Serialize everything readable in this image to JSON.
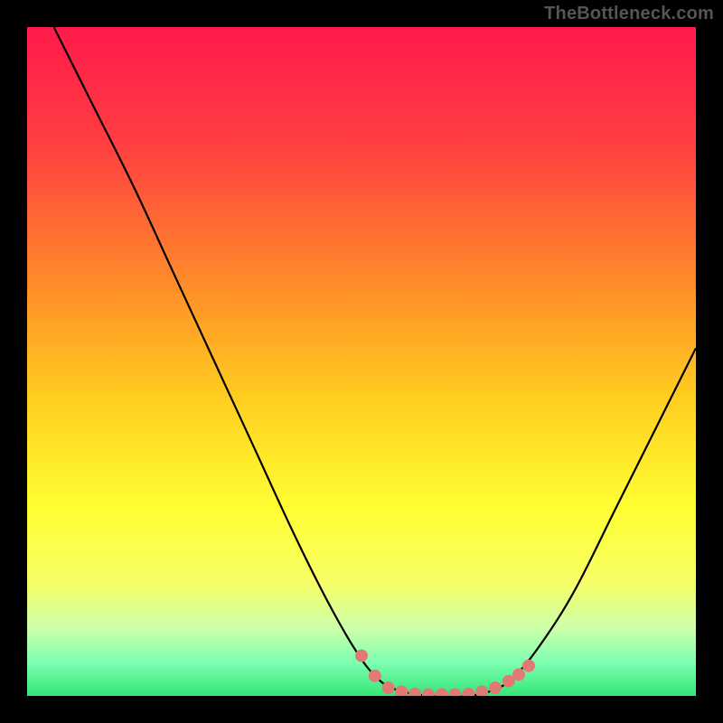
{
  "watermark": "TheBottleneck.com",
  "colors": {
    "background": "#000000",
    "curve": "#000000",
    "marker_fill": "#e17a75",
    "watermark": "#555555"
  },
  "gradient_stops": [
    {
      "offset": 0.0,
      "color": "#ff1a4b"
    },
    {
      "offset": 0.18,
      "color": "#ff4040"
    },
    {
      "offset": 0.38,
      "color": "#ff8a2a"
    },
    {
      "offset": 0.55,
      "color": "#ffcc1f"
    },
    {
      "offset": 0.72,
      "color": "#ffff33"
    },
    {
      "offset": 0.83,
      "color": "#f6ff66"
    },
    {
      "offset": 0.9,
      "color": "#ccffaa"
    },
    {
      "offset": 0.95,
      "color": "#7dffb0"
    },
    {
      "offset": 1.0,
      "color": "#33e676"
    }
  ],
  "chart_data": {
    "type": "line",
    "title": "",
    "xlabel": "",
    "ylabel": "",
    "xlim": [
      0,
      100
    ],
    "ylim": [
      0,
      100
    ],
    "curve": [
      {
        "x": 4,
        "y": 100
      },
      {
        "x": 6,
        "y": 96
      },
      {
        "x": 10,
        "y": 88
      },
      {
        "x": 16,
        "y": 76
      },
      {
        "x": 22,
        "y": 63
      },
      {
        "x": 28,
        "y": 50
      },
      {
        "x": 34,
        "y": 37
      },
      {
        "x": 40,
        "y": 24
      },
      {
        "x": 45,
        "y": 14
      },
      {
        "x": 49,
        "y": 7
      },
      {
        "x": 52,
        "y": 3
      },
      {
        "x": 55,
        "y": 1
      },
      {
        "x": 60,
        "y": 0
      },
      {
        "x": 66,
        "y": 0
      },
      {
        "x": 70,
        "y": 1
      },
      {
        "x": 73,
        "y": 3
      },
      {
        "x": 77,
        "y": 8
      },
      {
        "x": 82,
        "y": 16
      },
      {
        "x": 88,
        "y": 28
      },
      {
        "x": 94,
        "y": 40
      },
      {
        "x": 100,
        "y": 52
      }
    ],
    "markers": [
      {
        "x": 50,
        "y": 6
      },
      {
        "x": 52,
        "y": 3
      },
      {
        "x": 54,
        "y": 1.2
      },
      {
        "x": 56,
        "y": 0.6
      },
      {
        "x": 58,
        "y": 0.3
      },
      {
        "x": 60,
        "y": 0.2
      },
      {
        "x": 62,
        "y": 0.2
      },
      {
        "x": 64,
        "y": 0.2
      },
      {
        "x": 66,
        "y": 0.3
      },
      {
        "x": 68,
        "y": 0.6
      },
      {
        "x": 70,
        "y": 1.2
      },
      {
        "x": 72,
        "y": 2.2
      },
      {
        "x": 73.5,
        "y": 3.2
      },
      {
        "x": 75,
        "y": 4.5
      }
    ]
  }
}
